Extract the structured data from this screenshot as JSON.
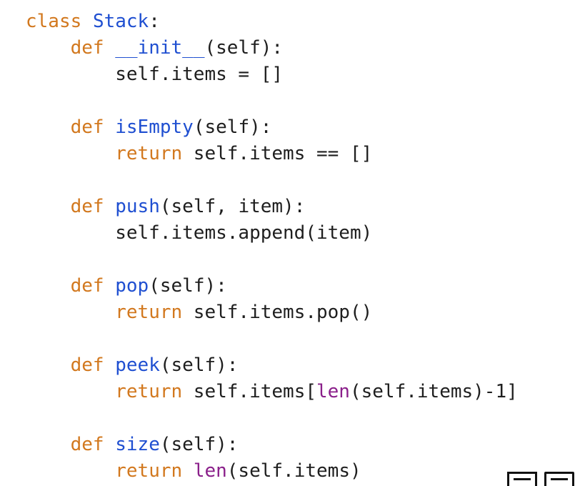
{
  "code": {
    "language": "python",
    "colors": {
      "keyword": "#d2781e",
      "function_name": "#1f4fd1",
      "builtin": "#8a1f8a",
      "text": "#1e1e1e"
    },
    "lines": [
      [
        {
          "t": "kw",
          "s": "class"
        },
        {
          "t": "tx",
          "s": " "
        },
        {
          "t": "fn",
          "s": "Stack"
        },
        {
          "t": "tx",
          "s": ":"
        }
      ],
      [
        {
          "t": "tx",
          "s": "    "
        },
        {
          "t": "kw",
          "s": "def"
        },
        {
          "t": "tx",
          "s": " "
        },
        {
          "t": "fn",
          "s": "__init__"
        },
        {
          "t": "tx",
          "s": "(self):"
        }
      ],
      [
        {
          "t": "tx",
          "s": "        self.items = []"
        }
      ],
      [],
      [
        {
          "t": "tx",
          "s": "    "
        },
        {
          "t": "kw",
          "s": "def"
        },
        {
          "t": "tx",
          "s": " "
        },
        {
          "t": "fn",
          "s": "isEmpty"
        },
        {
          "t": "tx",
          "s": "(self):"
        }
      ],
      [
        {
          "t": "tx",
          "s": "        "
        },
        {
          "t": "kw",
          "s": "return"
        },
        {
          "t": "tx",
          "s": " self.items == []"
        }
      ],
      [],
      [
        {
          "t": "tx",
          "s": "    "
        },
        {
          "t": "kw",
          "s": "def"
        },
        {
          "t": "tx",
          "s": " "
        },
        {
          "t": "fn",
          "s": "push"
        },
        {
          "t": "tx",
          "s": "(self, item):"
        }
      ],
      [
        {
          "t": "tx",
          "s": "        self.items.append(item)"
        }
      ],
      [],
      [
        {
          "t": "tx",
          "s": "    "
        },
        {
          "t": "kw",
          "s": "def"
        },
        {
          "t": "tx",
          "s": " "
        },
        {
          "t": "fn",
          "s": "pop"
        },
        {
          "t": "tx",
          "s": "(self):"
        }
      ],
      [
        {
          "t": "tx",
          "s": "        "
        },
        {
          "t": "kw",
          "s": "return"
        },
        {
          "t": "tx",
          "s": " self.items.pop()"
        }
      ],
      [],
      [
        {
          "t": "tx",
          "s": "    "
        },
        {
          "t": "kw",
          "s": "def"
        },
        {
          "t": "tx",
          "s": " "
        },
        {
          "t": "fn",
          "s": "peek"
        },
        {
          "t": "tx",
          "s": "(self):"
        }
      ],
      [
        {
          "t": "tx",
          "s": "        "
        },
        {
          "t": "kw",
          "s": "return"
        },
        {
          "t": "tx",
          "s": " self.items["
        },
        {
          "t": "bi",
          "s": "len"
        },
        {
          "t": "tx",
          "s": "(self.items)-1]"
        }
      ],
      [],
      [
        {
          "t": "tx",
          "s": "    "
        },
        {
          "t": "kw",
          "s": "def"
        },
        {
          "t": "tx",
          "s": " "
        },
        {
          "t": "fn",
          "s": "size"
        },
        {
          "t": "tx",
          "s": "(self):"
        }
      ],
      [
        {
          "t": "tx",
          "s": "        "
        },
        {
          "t": "kw",
          "s": "return"
        },
        {
          "t": "tx",
          "s": " "
        },
        {
          "t": "bi",
          "s": "len"
        },
        {
          "t": "tx",
          "s": "(self.items)"
        }
      ]
    ]
  }
}
